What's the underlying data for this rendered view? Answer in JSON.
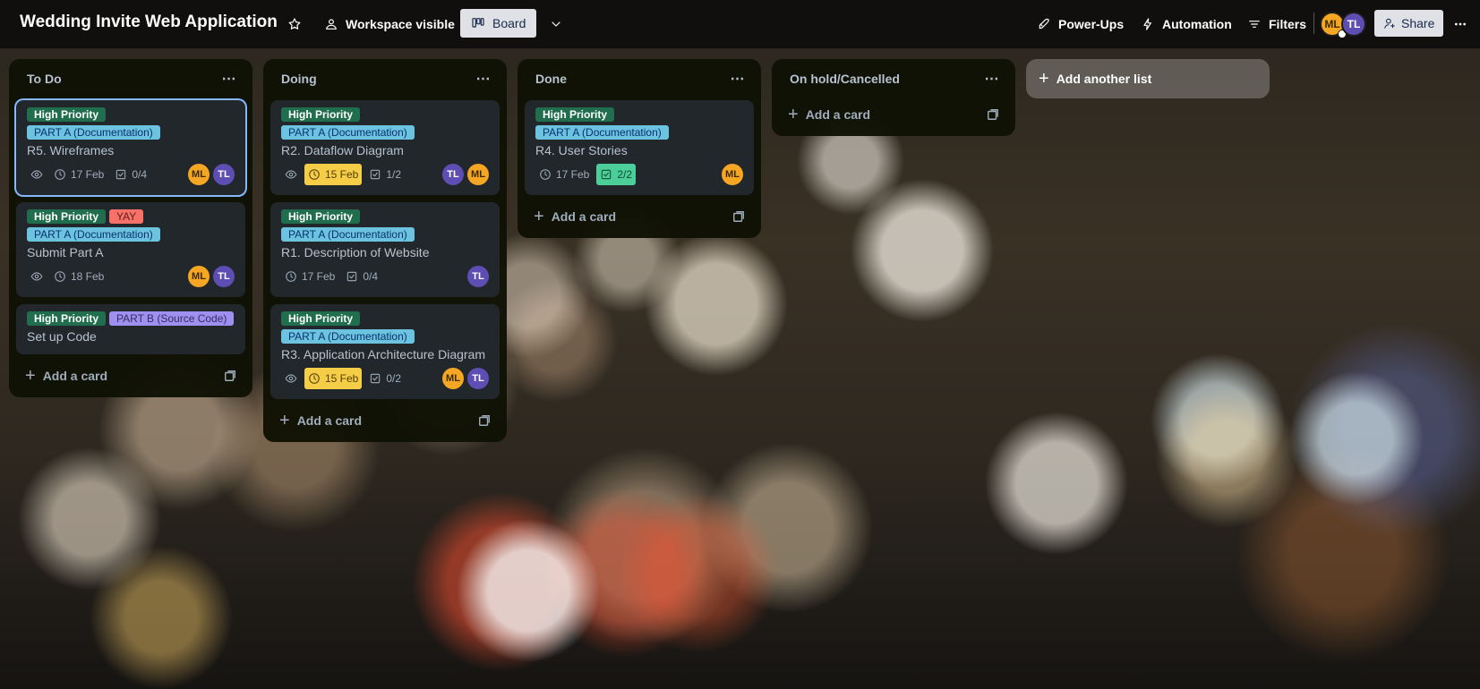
{
  "header": {
    "board_title": "Wedding Invite Web Application",
    "visibility_label": "Workspace visible",
    "view_label": "Board",
    "powerups_label": "Power-Ups",
    "automation_label": "Automation",
    "filters_label": "Filters",
    "share_label": "Share",
    "members": [
      "ML",
      "TL"
    ]
  },
  "lists": [
    {
      "title": "To Do",
      "add_card_label": "Add a card",
      "cards": [
        {
          "labels": [
            {
              "text": "High Priority",
              "color": "green"
            },
            {
              "text": "PART A (Documentation)",
              "color": "blue"
            }
          ],
          "title": "R5. Wireframes",
          "watching": true,
          "due": "17 Feb",
          "checklist": "0/4",
          "members": [
            "ML",
            "TL"
          ]
        },
        {
          "labels": [
            {
              "text": "High Priority",
              "color": "green"
            },
            {
              "text": "YAY",
              "color": "red"
            },
            {
              "text": "PART A (Documentation)",
              "color": "blue"
            }
          ],
          "title": "Submit Part A",
          "watching": true,
          "due": "18 Feb",
          "members": [
            "ML",
            "TL"
          ]
        },
        {
          "labels": [
            {
              "text": "High Priority",
              "color": "green"
            },
            {
              "text": "PART B (Source Code)",
              "color": "purple"
            }
          ],
          "title": "Set up Code"
        }
      ]
    },
    {
      "title": "Doing",
      "add_card_label": "Add a card",
      "cards": [
        {
          "labels": [
            {
              "text": "High Priority",
              "color": "green"
            },
            {
              "text": "PART A (Documentation)",
              "color": "blue"
            }
          ],
          "title": "R2. Dataflow Diagram",
          "watching": true,
          "due": "15 Feb",
          "checklist": "1/2",
          "members": [
            "TL",
            "ML"
          ]
        },
        {
          "labels": [
            {
              "text": "High Priority",
              "color": "green"
            },
            {
              "text": "PART A (Documentation)",
              "color": "blue"
            }
          ],
          "title": "R1. Description of Website",
          "due": "17 Feb",
          "checklist": "0/4",
          "members": [
            "TL"
          ]
        },
        {
          "labels": [
            {
              "text": "High Priority",
              "color": "green"
            },
            {
              "text": "PART A (Documentation)",
              "color": "blue"
            }
          ],
          "title": "R3. Application Architecture Diagram",
          "watching": true,
          "due": "15 Feb",
          "checklist": "0/2",
          "members": [
            "ML",
            "TL"
          ]
        }
      ]
    },
    {
      "title": "Done",
      "add_card_label": "Add a card",
      "cards": [
        {
          "labels": [
            {
              "text": "High Priority",
              "color": "green"
            },
            {
              "text": "PART A (Documentation)",
              "color": "blue"
            }
          ],
          "title": "R4. User Stories",
          "due": "17 Feb",
          "checklist": "2/2",
          "members": [
            "ML"
          ]
        }
      ]
    },
    {
      "title": "On hold/Cancelled",
      "add_card_label": "Add a card",
      "cards": []
    }
  ],
  "add_list_label": "Add another list",
  "colors": {
    "label_green": "#216e4e",
    "label_blue": "#6cc3e0",
    "label_red": "#f87168",
    "label_purple": "#9f8fef",
    "due_soon": "#f5cd47",
    "checklist_complete": "#4bce97",
    "avatar_ml": "#f5a623",
    "avatar_tl": "#5e4db2",
    "selected_outline": "#85b8ff"
  }
}
